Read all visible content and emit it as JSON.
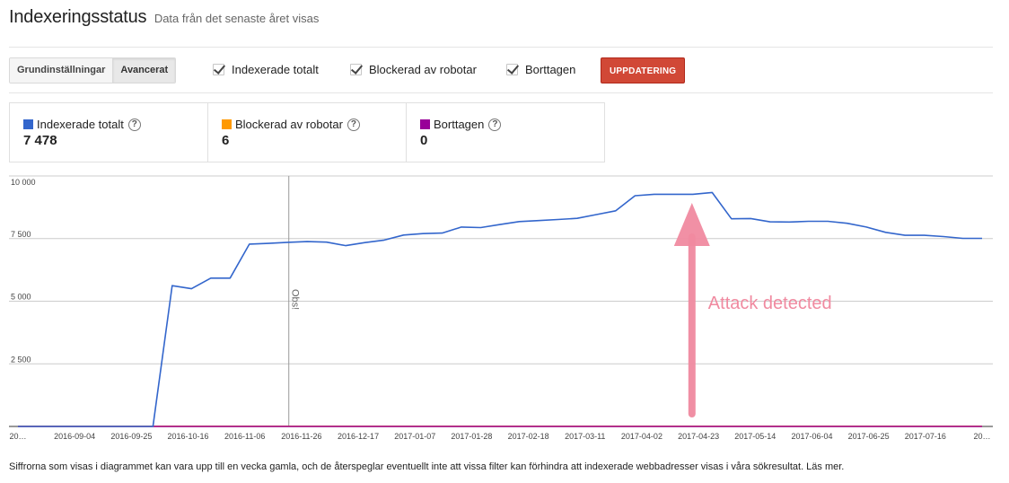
{
  "header": {
    "title": "Indexeringsstatus",
    "subtitle": "Data från det senaste året visas"
  },
  "toolbar": {
    "basic_label": "Grundinställningar",
    "advanced_label": "Avancerat",
    "checkboxes": [
      {
        "label": "Indexerade totalt",
        "checked": true
      },
      {
        "label": "Blockerad av robotar",
        "checked": true
      },
      {
        "label": "Borttagen",
        "checked": true
      }
    ],
    "update_label": "UPPDATERING"
  },
  "legend": [
    {
      "label": "Indexerade totalt",
      "value": "7 478",
      "color": "#3366cc",
      "icon": "help-icon"
    },
    {
      "label": "Blockerad av robotar",
      "value": "6",
      "color": "#ff9900",
      "icon": "help-icon"
    },
    {
      "label": "Borttagen",
      "value": "0",
      "color": "#990099",
      "icon": "help-icon"
    }
  ],
  "chart_data": {
    "type": "line",
    "y_ticks": [
      "10 000",
      "7 500",
      "5 000",
      "2 500"
    ],
    "ylim": [
      0,
      10000
    ],
    "grid": true,
    "x_tick_labels": [
      "20…",
      "2016-09-04",
      "2016-09-25",
      "2016-10-16",
      "2016-11-06",
      "2016-11-26",
      "2016-12-17",
      "2017-01-07",
      "2017-01-28",
      "2017-02-18",
      "2017-03-11",
      "2017-04-02",
      "2017-04-23",
      "2017-05-14",
      "2017-06-04",
      "2017-06-25",
      "2017-07-16",
      "20…"
    ],
    "series": [
      {
        "name": "Indexerade totalt",
        "color": "#3366cc",
        "values": [
          0,
          0,
          0,
          0,
          0,
          0,
          0,
          0,
          5620,
          5500,
          5920,
          5920,
          7280,
          7310,
          7350,
          7380,
          7360,
          7220,
          7340,
          7440,
          7640,
          7700,
          7720,
          7960,
          7940,
          8060,
          8180,
          8220,
          8260,
          8310,
          8460,
          8610,
          9210,
          9270,
          9270,
          9270,
          9340,
          8290,
          8300,
          8170,
          8160,
          8190,
          8190,
          8110,
          7960,
          7750,
          7630,
          7630,
          7580,
          7510,
          7510
        ]
      },
      {
        "name": "Blockerad av robotar",
        "color": "#ff9900",
        "values": [
          6,
          6,
          6,
          6,
          6,
          6,
          6,
          6,
          6,
          6,
          6,
          6,
          6,
          6,
          6,
          6,
          6,
          6,
          6,
          6,
          6,
          6,
          6,
          6,
          6,
          6,
          6,
          6,
          6,
          6,
          6,
          6,
          6,
          6,
          6,
          6,
          6,
          6,
          6,
          6,
          6,
          6,
          6,
          6,
          6,
          6,
          6,
          6,
          6,
          6,
          6
        ]
      },
      {
        "name": "Borttagen",
        "color": "#990099",
        "values": [
          0,
          0,
          0,
          0,
          0,
          0,
          0,
          0,
          0,
          0,
          0,
          0,
          0,
          0,
          0,
          0,
          0,
          0,
          0,
          0,
          0,
          0,
          0,
          0,
          0,
          0,
          0,
          0,
          0,
          0,
          0,
          0,
          0,
          0,
          0,
          0,
          0,
          0,
          0,
          0,
          0,
          0,
          0,
          0,
          0,
          0,
          0,
          0,
          0,
          0,
          0
        ]
      }
    ],
    "event_marker": {
      "label": "Obs!",
      "index": 14
    },
    "annotation": {
      "text": "Attack detected",
      "color": "#f08aa0",
      "arrow_index": 35
    }
  },
  "footer": {
    "text": "Siffrorna som visas i diagrammet kan vara upp till en vecka gamla, och de återspeglar eventuellt inte att vissa filter kan förhindra att indexerade webbadresser visas i våra sökresultat. Läs mer."
  }
}
